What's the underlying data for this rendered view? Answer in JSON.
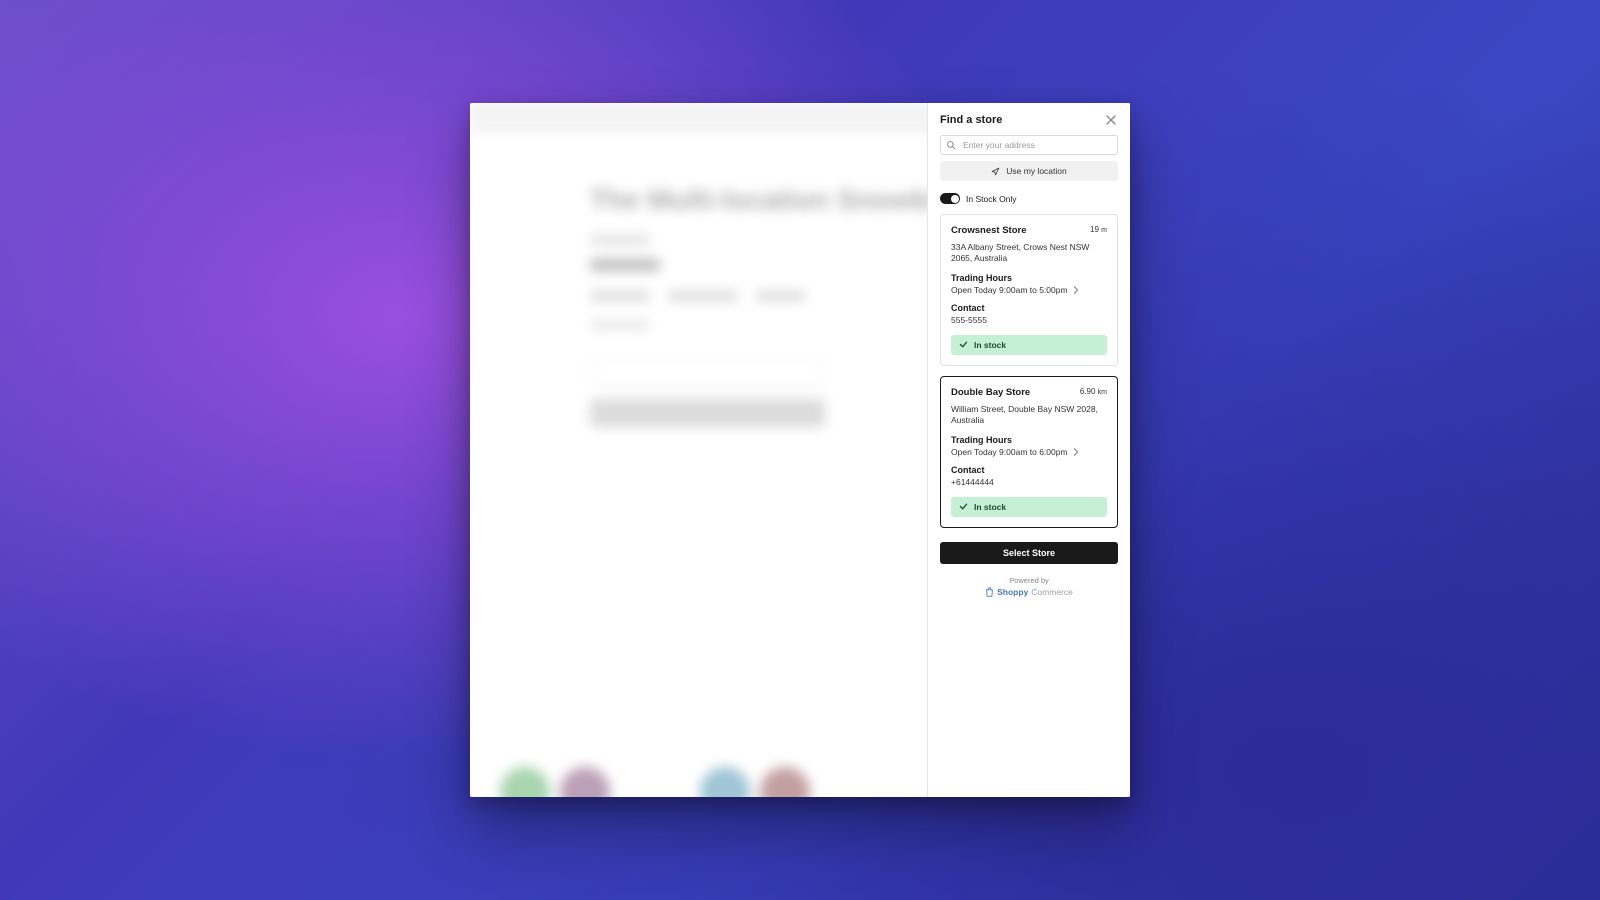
{
  "background": {
    "product_title": "The Multi-location Snowboard"
  },
  "panel": {
    "title": "Find a store",
    "search_placeholder": "Enter your address",
    "use_location_label": "Use my location",
    "toggle_label": "In Stock Only",
    "select_button": "Select Store",
    "powered_label": "Powered by",
    "brand1": "Shoppy",
    "brand2": "Commerce"
  },
  "stores": [
    {
      "name": "Crowsnest Store",
      "distance_value": "19",
      "distance_unit": "m",
      "address": "33A Albany Street, Crows Nest NSW 2065, Australia",
      "hours_heading": "Trading Hours",
      "hours_text": "Open Today 9:00am to 5:00pm",
      "contact_heading": "Contact",
      "contact_value": "555-5555",
      "stock_label": "In stock",
      "selected": false
    },
    {
      "name": "Double Bay Store",
      "distance_value": "6.90",
      "distance_unit": "km",
      "address": "William Street, Double Bay NSW 2028, Australia",
      "hours_heading": "Trading Hours",
      "hours_text": "Open Today 9:00am to 6:00pm",
      "contact_heading": "Contact",
      "contact_value": "+61444444",
      "stock_label": "In stock",
      "selected": true
    }
  ]
}
